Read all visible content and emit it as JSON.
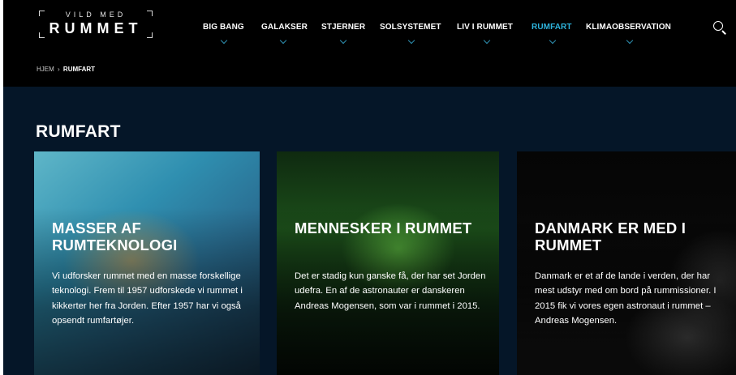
{
  "header": {
    "logo": {
      "line1": "VILD MED",
      "line2": "RUMMET"
    },
    "nav": [
      {
        "label": "BIG BANG",
        "active": false
      },
      {
        "label": "GALAKSER",
        "active": false
      },
      {
        "label": "STJERNER",
        "active": false
      },
      {
        "label": "SOLSYSTEMET",
        "active": false
      },
      {
        "label": "LIV I RUMMET",
        "active": false
      },
      {
        "label": "RUMFART",
        "active": true
      },
      {
        "label": "KLIMAOBSERVATION",
        "active": false
      }
    ],
    "search_icon": "search-icon"
  },
  "breadcrumb": {
    "home": "HJEM",
    "separator": "›",
    "current": "RUMFART"
  },
  "page": {
    "title": "RUMFART"
  },
  "cards": [
    {
      "title": "MASSER AF RUMTEKNOLOGI",
      "text": "Vi udforsker rummet med en masse forskellige teknologi. Frem til 1957 udforskede vi rummet i kikkerter her fra Jorden. Efter 1957 har vi også opsendt rumfartøjer."
    },
    {
      "title": "MENNESKER I RUMMET",
      "text": "Det er stadig kun ganske få, der har set Jorden udefra. En af de astronauter er danskeren Andreas Mogensen, som var i rummet i 2015."
    },
    {
      "title": "DANMARK ER MED I RUMMET",
      "text": "Danmark er et af de lande i verden, der har mest udstyr med om bord på rummissioner. I 2015 fik vi vores egen astronaut i rummet – Andreas Mogensen."
    }
  ],
  "colors": {
    "active_nav": "#2eb3dc",
    "page_background": "#051628",
    "header_background": "#000000"
  }
}
